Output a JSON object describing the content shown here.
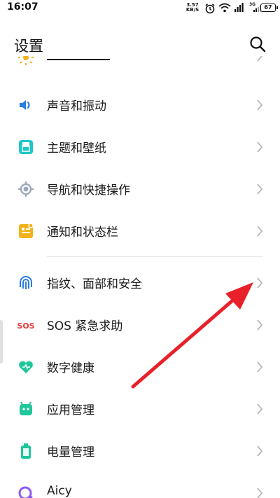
{
  "status_bar": {
    "time": "16:07",
    "net_speed_value": "3.57",
    "net_speed_unit": "KB/S",
    "signal_label": "3G",
    "battery": "67"
  },
  "header": {
    "title": "设置",
    "search_icon": "search-icon"
  },
  "settings": {
    "items": [
      {
        "label": "声音和振动",
        "icon": "sound-icon",
        "color": "#2a7de1"
      },
      {
        "label": "主题和壁纸",
        "icon": "theme-icon",
        "color": "#1ec8c8"
      },
      {
        "label": "导航和快捷操作",
        "icon": "navigation-icon",
        "color": "#9aa7b8"
      },
      {
        "label": "通知和状态栏",
        "icon": "notification-icon",
        "color": "#f2b21b"
      },
      {
        "label": "指纹、面部和安全",
        "icon": "fingerprint-icon",
        "color": "#2a7de1"
      },
      {
        "label": "SOS 紧急求助",
        "icon": "sos-icon",
        "color": "#e53935"
      },
      {
        "label": "数字健康",
        "icon": "digital-wellbeing-icon",
        "color": "#1fc79a"
      },
      {
        "label": "应用管理",
        "icon": "app-management-icon",
        "color": "#1fc79a"
      },
      {
        "label": "电量管理",
        "icon": "battery-management-icon",
        "color": "#1fc79a"
      },
      {
        "label": "Aicy",
        "icon": "aicy-icon",
        "color": "#8a5cf6"
      }
    ]
  },
  "annotation": {
    "arrow_color": "#e8202a"
  }
}
